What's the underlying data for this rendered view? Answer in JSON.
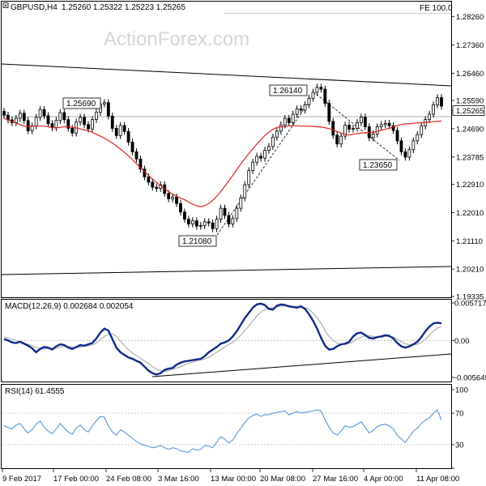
{
  "header": {
    "symbol": "GBPUSD,H4",
    "ohlc": "1.25260 1.25322 1.25223 1.25265",
    "fe_label": "FE 100.0",
    "watermark": "ActionForex.com"
  },
  "colors": {
    "candle": "#000000",
    "ma": "#dd2222",
    "macd": "#102a8a",
    "signal": "#b0b0b0",
    "rsi": "#4a8fd6",
    "box_bg": "#ffffff"
  },
  "chart_data": [
    {
      "type": "line",
      "subtype": "candlestick-with-moving-average",
      "title": "GBPUSD,H4 1.25260 1.25322 1.25223 1.25265",
      "ylim": [
        1.19335,
        1.2864
      ],
      "y_ticks": [
        "1.28260",
        "1.27360",
        "1.26460",
        "1.25590",
        "1.25265",
        "1.24690",
        "1.23785",
        "1.22910",
        "1.22010",
        "1.21110",
        "1.20210",
        "1.19335"
      ],
      "x_ticks": [
        "9 Feb 2017",
        "17 Feb 00:00",
        "24 Feb 08:00",
        "3 Mar 16:00",
        "13 Mar 00:00",
        "20 Mar 08:00",
        "27 Mar 16:00",
        "4 Apr 00:00",
        "11 Apr 08:00"
      ],
      "current_price": "1.25265",
      "annotations": [
        {
          "text": "1.25690",
          "value": 1.2569
        },
        {
          "text": "1.21080",
          "value": 1.2108
        },
        {
          "text": "1.26140",
          "value": 1.2614
        },
        {
          "text": "1.23650",
          "value": 1.2365
        },
        {
          "text": "FE 100.0",
          "value": 1.2829
        }
      ],
      "series": [
        {
          "name": "close",
          "values": [
            1.2512,
            1.2497,
            1.2488,
            1.2502,
            1.2518,
            1.2495,
            1.2462,
            1.2478,
            1.2505,
            1.253,
            1.251,
            1.2485,
            1.2472,
            1.2495,
            1.252,
            1.2498,
            1.247,
            1.2455,
            1.249,
            1.2505,
            1.2482,
            1.2468,
            1.2498,
            1.2521,
            1.2548,
            1.2552,
            1.2509,
            1.247,
            1.2447,
            1.2479,
            1.246,
            1.2426,
            1.2395,
            1.2372,
            1.234,
            1.2315,
            1.2298,
            1.2282,
            1.2278,
            1.229,
            1.2262,
            1.2245,
            1.2251,
            1.223,
            1.2203,
            1.218,
            1.2165,
            1.2175,
            1.2158,
            1.216,
            1.2172,
            1.2168,
            1.215,
            1.218,
            1.2215,
            1.2192,
            1.2165,
            1.2182,
            1.2215,
            1.2248,
            1.229,
            1.2335,
            1.2362,
            1.2381,
            1.2375,
            1.24,
            1.2412,
            1.2442,
            1.2461,
            1.2481,
            1.2502,
            1.2488,
            1.2515,
            1.2532,
            1.2528,
            1.2545,
            1.2566,
            1.2585,
            1.2601,
            1.2595,
            1.255,
            1.2492,
            1.2448,
            1.242,
            1.2445,
            1.248,
            1.2467,
            1.247,
            1.2488,
            1.2506,
            1.2475,
            1.244,
            1.2452,
            1.2475,
            1.2482,
            1.2486,
            1.2478,
            1.2463,
            1.243,
            1.2395,
            1.2378,
            1.2402,
            1.243,
            1.245,
            1.2478,
            1.2498,
            1.2515,
            1.2545,
            1.2568,
            1.2541
          ]
        },
        {
          "name": "ma",
          "values": [
            1.2502,
            1.2497,
            1.2491,
            1.2487,
            1.2482,
            1.2477,
            1.2476,
            1.2477,
            1.2477,
            1.2477,
            1.2477,
            1.2475,
            1.2472,
            1.2471,
            1.2473,
            1.2475,
            1.2475,
            1.2473,
            1.2471,
            1.2468,
            1.2465,
            1.2462,
            1.2457,
            1.2451,
            1.2445,
            1.2439,
            1.2431,
            1.2423,
            1.2414,
            1.2404,
            1.2393,
            1.2382,
            1.237,
            1.2357,
            1.2344,
            1.2332,
            1.232,
            1.2308,
            1.2297,
            1.2287,
            1.2277,
            1.2268,
            1.226,
            1.2253,
            1.2247,
            1.2242,
            1.2235,
            1.2228,
            1.2223,
            1.222,
            1.2223,
            1.223,
            1.224,
            1.2253,
            1.2268,
            1.2285,
            1.2302,
            1.232,
            1.2338,
            1.2356,
            1.2373,
            1.239,
            1.2405,
            1.242,
            1.2434,
            1.2447,
            1.2458,
            1.2467,
            1.2473,
            1.2475,
            1.2476,
            1.2478,
            1.2478,
            1.2478,
            1.2477,
            1.2477,
            1.2477,
            1.2476,
            1.2475,
            1.2474,
            1.2472,
            1.2469,
            1.2465,
            1.246,
            1.2455,
            1.2451,
            1.2449,
            1.2451,
            1.2453,
            1.2455,
            1.2456,
            1.2457,
            1.2458,
            1.246,
            1.2464,
            1.2467,
            1.247,
            1.2475,
            1.2479,
            1.2482,
            1.2484,
            1.2485,
            1.2486,
            1.2487,
            1.2488,
            1.2489,
            1.249,
            1.2491,
            1.2492,
            1.2493
          ]
        }
      ]
    },
    {
      "type": "line",
      "title": "MACD(12,26,9) 0.002684 0.002054",
      "ylim": [
        -0.005645,
        0.005717
      ],
      "y_ticks": [
        "0.005717",
        "0.00",
        "-0.005645"
      ],
      "series": [
        {
          "name": "MACD",
          "values": [
            0.0002,
            0.0,
            -0.0003,
            -0.0004,
            -0.0002,
            -0.0005,
            -0.0008,
            -0.0012,
            -0.0018,
            -0.0013,
            -0.001,
            -0.0011,
            -0.0014,
            -0.0009,
            -0.0006,
            -0.0007,
            -0.0011,
            -0.0013,
            -0.001,
            -0.0007,
            -0.0008,
            -0.0006,
            -0.0004,
            0.0003,
            0.0012,
            0.0018,
            0.0015,
            0.0002,
            -0.0011,
            -0.0018,
            -0.0022,
            -0.0026,
            -0.0028,
            -0.0031,
            -0.0034,
            -0.004,
            -0.0046,
            -0.005,
            -0.0052,
            -0.005,
            -0.0045,
            -0.0043,
            -0.0042,
            -0.0037,
            -0.0034,
            -0.0032,
            -0.0031,
            -0.003,
            -0.0029,
            -0.0028,
            -0.0024,
            -0.0018,
            -0.0014,
            -0.001,
            -0.0005,
            -0.0003,
            0.0,
            0.0006,
            0.0014,
            0.0024,
            0.0034,
            0.0042,
            0.005,
            0.0055,
            0.0056,
            0.0054,
            0.0048,
            0.0047,
            0.0053,
            0.0055,
            0.0054,
            0.0052,
            0.0051,
            0.005,
            0.0052,
            0.0048,
            0.004,
            0.003,
            0.0018,
            0.0004,
            -0.0008,
            -0.0014,
            -0.0013,
            -0.0009,
            -0.0006,
            -0.0005,
            -0.0002,
            0.0006,
            0.0011,
            0.0012,
            0.0008,
            0.0004,
            0.0003,
            0.0005,
            0.0006,
            0.0008,
            0.0007,
            0.0003,
            -0.0004,
            -0.0009,
            -0.0011,
            -0.0009,
            -0.0006,
            -0.0002,
            0.0005,
            0.0014,
            0.0021,
            0.0026,
            0.0027,
            0.0026
          ]
        },
        {
          "name": "Signal",
          "values": [
            0.0005,
            0.0004,
            0.0002,
            0.0,
            -0.0002,
            -0.0004,
            -0.0006,
            -0.0008,
            -0.0011,
            -0.0013,
            -0.0013,
            -0.0012,
            -0.0012,
            -0.0012,
            -0.001,
            -0.0009,
            -0.0009,
            -0.001,
            -0.0011,
            -0.001,
            -0.0009,
            -0.0008,
            -0.0007,
            -0.0004,
            0.0001,
            0.0006,
            0.001,
            0.001,
            0.0006,
            -0.0001,
            -0.0008,
            -0.0014,
            -0.0019,
            -0.0023,
            -0.0027,
            -0.0031,
            -0.0035,
            -0.004,
            -0.0044,
            -0.0046,
            -0.0047,
            -0.0046,
            -0.0044,
            -0.0042,
            -0.004,
            -0.0037,
            -0.0035,
            -0.0033,
            -0.0031,
            -0.003,
            -0.0028,
            -0.0026,
            -0.0022,
            -0.0018,
            -0.0014,
            -0.001,
            -0.0006,
            -0.0003,
            0.0002,
            0.0008,
            0.0015,
            0.0022,
            0.003,
            0.0037,
            0.0043,
            0.0047,
            0.0049,
            0.005,
            0.0051,
            0.0052,
            0.0053,
            0.0053,
            0.0052,
            0.0052,
            0.0051,
            0.005,
            0.0047,
            0.0042,
            0.0035,
            0.0026,
            0.0015,
            0.0006,
            0.0,
            -0.0004,
            -0.0006,
            -0.0006,
            -0.0005,
            -0.0002,
            0.0002,
            0.0005,
            0.0007,
            0.0007,
            0.0006,
            0.0005,
            0.0005,
            0.0006,
            0.0006,
            0.0005,
            0.0002,
            -0.0002,
            -0.0005,
            -0.0007,
            -0.0007,
            -0.0006,
            -0.0003,
            0.0002,
            0.0008,
            0.0014,
            0.0019,
            0.0021
          ]
        }
      ]
    },
    {
      "type": "line",
      "title": "RSI(14) 61.4555",
      "ylim": [
        0,
        100
      ],
      "y_ticks": [
        "100",
        "70",
        "30",
        "0"
      ],
      "levels": [
        70,
        30
      ],
      "series": [
        {
          "name": "RSI",
          "values": [
            54,
            52,
            50,
            55,
            57,
            50,
            45,
            49,
            56,
            60,
            52,
            47,
            44,
            50,
            57,
            51,
            46,
            43,
            51,
            55,
            49,
            46,
            54,
            60,
            66,
            65,
            54,
            46,
            42,
            49,
            46,
            42,
            38,
            34,
            31,
            29,
            28,
            26,
            27,
            29,
            26,
            24,
            26,
            25,
            22,
            21,
            20,
            25,
            23,
            24,
            29,
            28,
            26,
            33,
            40,
            37,
            32,
            36,
            44,
            51,
            58,
            64,
            67,
            69,
            66,
            68,
            68,
            70,
            71,
            72,
            73,
            68,
            70,
            72,
            70,
            71,
            72,
            73,
            74,
            73,
            62,
            52,
            45,
            42,
            47,
            54,
            52,
            53,
            56,
            59,
            52,
            45,
            48,
            53,
            55,
            56,
            54,
            50,
            42,
            37,
            33,
            40,
            47,
            51,
            57,
            61,
            64,
            70,
            74,
            61
          ]
        }
      ]
    }
  ]
}
